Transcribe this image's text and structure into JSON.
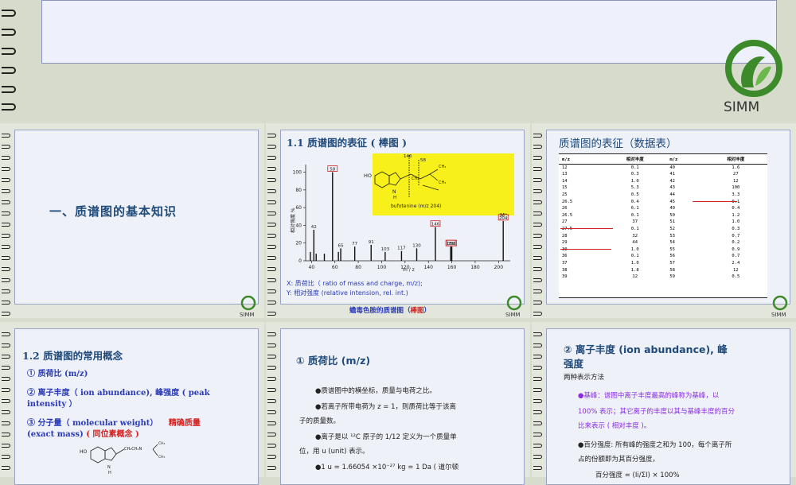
{
  "slide1": {
    "title": "一、质谱图的基本知识"
  },
  "slide2": {
    "title": "1.1   质谱图的表征 ( 棒图 )",
    "compound": "bufotenine (m/z 204)",
    "x_desc": "X:  质荷比（ ratio of mass and charge, m/z);",
    "y_desc": "Y:  相对强度  (relative intension, rel. int.)",
    "caption_main": "蟾毒色胺的质谱图（",
    "caption_red": "棒图",
    "caption_end": "）",
    "ylabel": "相对强度 %",
    "xlabel": "m / z",
    "mol_label": "M⁺·",
    "frag_146": "146",
    "frag_58": "58"
  },
  "slide3": {
    "title": "质谱图的表征（数据表）",
    "headers": [
      "m/z",
      "相对丰度",
      "m/z",
      "相对丰度"
    ],
    "rows": [
      [
        "12",
        "0.1",
        "40",
        "1.6"
      ],
      [
        "13",
        "0.3",
        "41",
        "27"
      ],
      [
        "14",
        "1.0",
        "42",
        "12"
      ],
      [
        "15",
        "5.3",
        "43",
        "100"
      ],
      [
        "25",
        "0.5",
        "44",
        "3.3"
      ],
      [
        "26.5",
        "0.4",
        "45",
        "0.1"
      ],
      [
        "26",
        "6.1",
        "49",
        "0.4"
      ],
      [
        "26.5",
        "0.1",
        "50",
        "1.2"
      ],
      [
        "27",
        "37",
        "51",
        "1.0"
      ],
      [
        "27.5",
        "0.1",
        "52",
        "0.3"
      ],
      [
        "28",
        "32",
        "53",
        "0.7"
      ],
      [
        "29",
        "44",
        "54",
        "0.2"
      ],
      [
        "30",
        "1.0",
        "55",
        "0.9"
      ],
      [
        "36",
        "0.1",
        "56",
        "0.7"
      ],
      [
        "37",
        "1.0",
        "57",
        "2.4"
      ],
      [
        "38",
        "1.8",
        "58",
        "12"
      ],
      [
        "39",
        "12",
        "59",
        "0.5"
      ]
    ]
  },
  "slide4": {
    "title": "1.2  质谱图的常用概念",
    "i1": "①   质荷比  (m/z)",
    "i2a": "②   离子丰度（ ion abundance), 峰强度 ( peak",
    "i2b": "intensity ）",
    "i3a": "③   分子量（ molecular weight）",
    "i3red": "精确质量",
    "i3b": "(exact mass)",
    "i3red2": "( 同位素概念 )"
  },
  "slide5": {
    "title": "① 质荷比  (m/z)",
    "b1": "●质谱图中的横坐标，质量与电荷之比。",
    "b2a": "●若离子所带电荷为 z = 1，则质荷比等于该离",
    "b2b": "子的质量数。",
    "b3a": "●离子是以 ¹²C 原子的 1/12 定义为一个质量单",
    "b3b": "位，用 u (unit) 表示。",
    "b4": "●1 u = 1.66054 ×10⁻²⁷ kg   =  1 Da ( 道尔顿"
  },
  "slide6": {
    "title_a": "② 离子丰度 (ion abundance), 峰",
    "title_b": "强度",
    "sub": "两种表示方法",
    "p1a": "●基峰：谱图中离子丰度最高的峰称为基峰，以",
    "p1b": "100% 表示；其它离子的丰度以其与基峰丰度的百分",
    "p1c": "比来表示 ( 相对丰度 )。",
    "p2a": "●百分强度:  所有峰的强度之和为 100，每个离子所",
    "p2b": "占的份额即为其百分强度，",
    "p2c": "百分强度 = (Ii/ΣI) × 100%"
  },
  "logo": {
    "text": "SIMM"
  },
  "colors": {
    "accent": "#1f4a7a",
    "red": "#d42020",
    "purple": "#8a2be2",
    "logo_green": "#3d8a2a"
  },
  "chart_data": {
    "type": "bar",
    "title": "",
    "xlabel": "m / z",
    "ylabel": "相对强度 %",
    "xlim": [
      35,
      210
    ],
    "ylim": [
      0,
      105
    ],
    "x_ticks": [
      40,
      60,
      80,
      100,
      120,
      140,
      160,
      180,
      200
    ],
    "y_ticks": [
      0,
      20,
      40,
      60,
      80,
      100
    ],
    "peaks": [
      {
        "x": 39,
        "y": 10
      },
      {
        "x": 42,
        "y": 35,
        "label": "42"
      },
      {
        "x": 44,
        "y": 8
      },
      {
        "x": 51,
        "y": 8
      },
      {
        "x": 58,
        "y": 100,
        "label": "58"
      },
      {
        "x": 63,
        "y": 10
      },
      {
        "x": 65,
        "y": 14,
        "label": "65"
      },
      {
        "x": 77,
        "y": 16,
        "label": "77"
      },
      {
        "x": 91,
        "y": 18,
        "label": "91"
      },
      {
        "x": 103,
        "y": 10,
        "label": "103"
      },
      {
        "x": 117,
        "y": 11,
        "label": "117"
      },
      {
        "x": 130,
        "y": 14,
        "label": "130"
      },
      {
        "x": 146,
        "y": 38,
        "label": "146"
      },
      {
        "x": 159,
        "y": 16,
        "label": "159"
      },
      {
        "x": 160,
        "y": 16,
        "label": "160"
      },
      {
        "x": 204,
        "y": 45,
        "label": "204"
      }
    ]
  }
}
